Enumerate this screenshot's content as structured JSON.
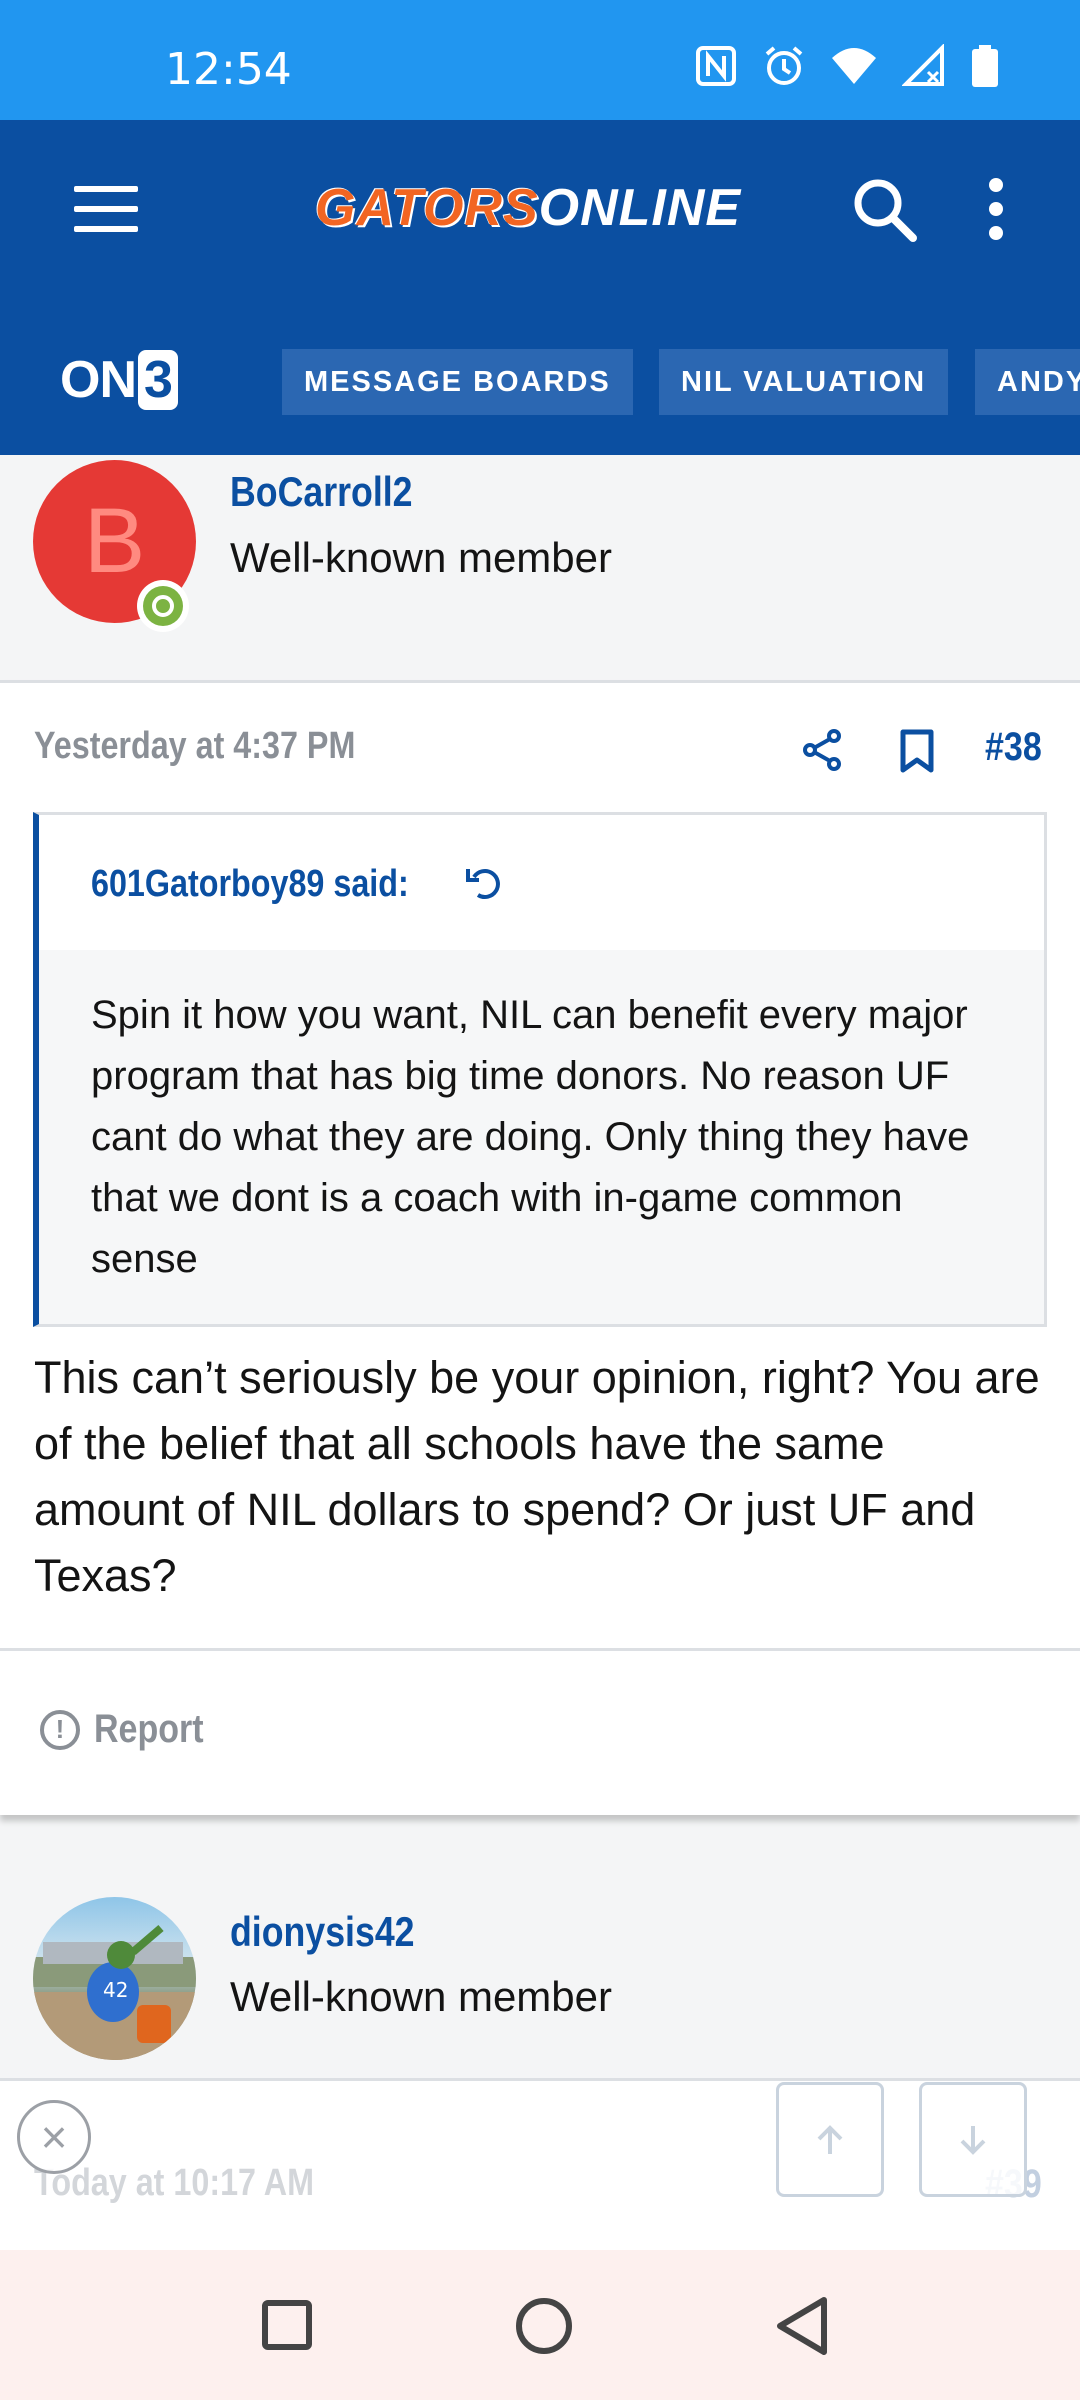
{
  "status_bar": {
    "time": "12:54"
  },
  "header": {
    "logo_part1": "GATORS",
    "logo_part2": "ONLINE",
    "brand": "ON",
    "brand_box": "3",
    "nav_tabs": [
      "MESSAGE BOARDS",
      "NIL VALUATION",
      "ANDY"
    ]
  },
  "posts": [
    {
      "avatar_letter": "B",
      "username": "BoCarroll2",
      "user_title": "Well-known member",
      "date": "Yesterday at 4:37 PM",
      "post_number": "#38",
      "quote": {
        "author": "601Gatorboy89 said:",
        "text": "Spin it how you want, NIL can benefit every major program that has big time donors. No reason UF cant do what they are doing. Only thing they have that we dont is a coach with in-game common sense"
      },
      "body": "This can’t seriously be your opinion, right? You are of the belief that all schools have the same amount of NIL dollars to spend? Or just UF and Texas?",
      "report_label": "Report"
    },
    {
      "username": "dionysis42",
      "user_title": "Well-known member",
      "date": "Today at 10:17 AM",
      "post_number": "#39"
    }
  ],
  "icons": {
    "menu": "hamburger-menu-icon",
    "search": "search-icon",
    "more": "more-vertical-icon",
    "share": "share-icon",
    "bookmark": "bookmark-icon",
    "report": "report-icon",
    "close": "close-icon",
    "scroll_up": "arrow-up-icon",
    "scroll_down": "arrow-down-icon"
  },
  "colors": {
    "status_bar": "#2196f0",
    "header": "#0b4fa1",
    "accent": "#0b4fa1",
    "logo_orange": "#f26522",
    "avatar_red": "#e53935",
    "online_green": "#7cb342"
  }
}
